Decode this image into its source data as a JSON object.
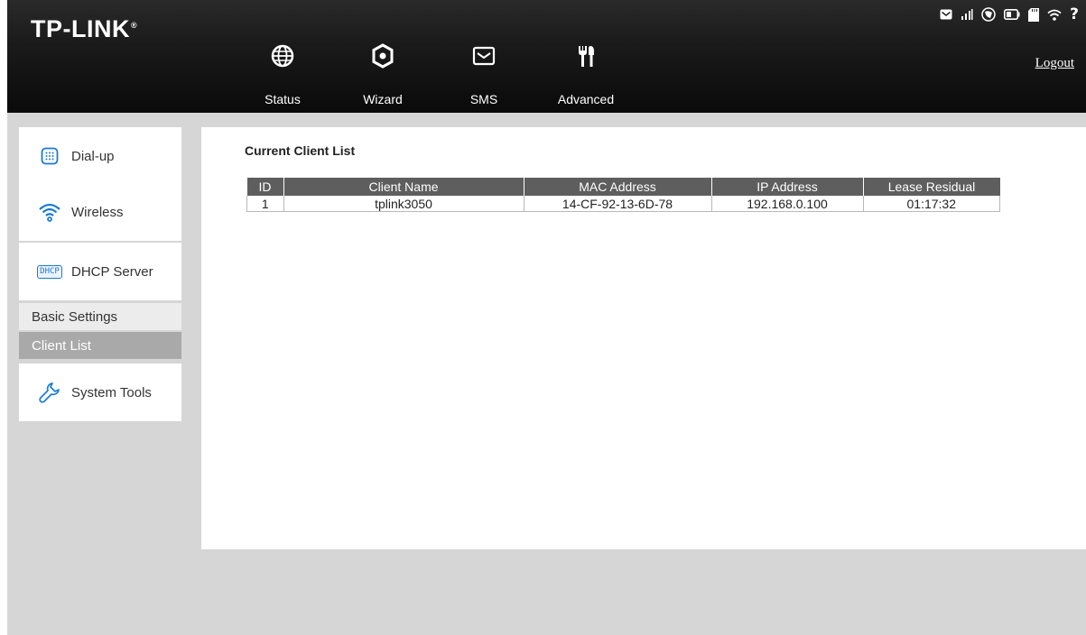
{
  "header": {
    "logo": "TP-LINK",
    "logo_mark": "®",
    "logout": "Logout",
    "nav": [
      {
        "label": "Status",
        "icon": "globe-icon"
      },
      {
        "label": "Wizard",
        "icon": "wizard-icon"
      },
      {
        "label": "SMS",
        "icon": "envelope-icon"
      },
      {
        "label": "Advanced",
        "icon": "tools-icon"
      }
    ],
    "status_icons": [
      "mail-icon",
      "signal-icon",
      "sim-icon",
      "battery-icon",
      "sd-card-icon",
      "wifi-icon",
      "help-icon"
    ]
  },
  "sidebar": {
    "items": [
      {
        "label": "Dial-up",
        "icon": "dialup-icon"
      },
      {
        "label": "Wireless",
        "icon": "wireless-icon"
      },
      {
        "label": "DHCP Server",
        "icon": "dhcp-icon",
        "icon_text": "DHCP"
      },
      {
        "label": "System Tools",
        "icon": "wrench-icon"
      }
    ],
    "sub_items": [
      {
        "label": "Basic Settings",
        "active": false
      },
      {
        "label": "Client List",
        "active": true
      }
    ]
  },
  "main": {
    "title": "Current Client List",
    "table": {
      "headers": [
        "ID",
        "Client Name",
        "MAC Address",
        "IP Address",
        "Lease Residual"
      ],
      "rows": [
        [
          "1",
          "tplink3050",
          "14-CF-92-13-6D-78",
          "192.168.0.100",
          "01:17:32"
        ]
      ]
    }
  },
  "colors": {
    "header_bg": "#111111",
    "page_bg": "#d6d6d6",
    "table_header_bg": "#5e5e5e",
    "active_sub_bg": "#a9a9a9",
    "icon_blue": "#1a7bd6"
  }
}
